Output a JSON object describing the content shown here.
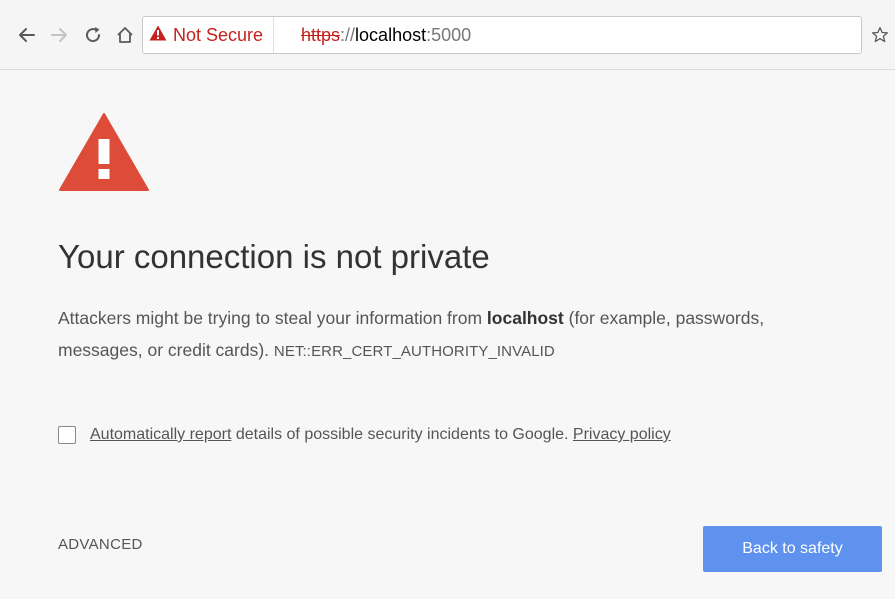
{
  "browser": {
    "nav": {
      "back_icon": "arrow-left-icon",
      "forward_icon": "arrow-right-icon",
      "reload_icon": "reload-icon",
      "home_icon": "home-icon"
    },
    "security_chip": {
      "icon": "warning-triangle-icon",
      "label": "Not Secure",
      "color": "#c5221f"
    },
    "url": {
      "scheme": "https",
      "separator": "://",
      "host": "localhost",
      "port": ":5000"
    },
    "bookmark_icon": "star-icon"
  },
  "interstitial": {
    "warning_icon": "warning-triangle-icon",
    "warning_color": "#dd4b39",
    "heading": "Your connection is not private",
    "message_part1": "Attackers might be trying to steal your information from ",
    "message_host": "localhost",
    "message_part2": " (for example, passwords, messages, or credit cards). ",
    "error_code": "NET::ERR_CERT_AUTHORITY_INVALID",
    "report": {
      "checked": false,
      "link_label": "Automatically report",
      "text": " details of possible security incidents to Google. ",
      "privacy_label": "Privacy policy"
    },
    "advanced_label": "ADVANCED",
    "back_button_label": "Back to safety",
    "back_button_color": "#5f92ee"
  }
}
